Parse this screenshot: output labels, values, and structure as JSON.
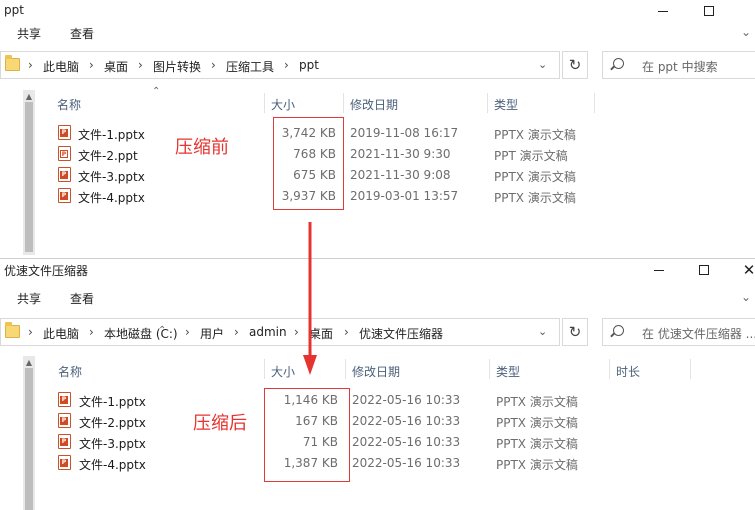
{
  "window1": {
    "title": "ppt",
    "ribbon": {
      "tabs": [
        "共享",
        "查看"
      ]
    },
    "address": {
      "crumbs": [
        "此电脑",
        "桌面",
        "图片转换",
        "压缩工具",
        "ppt"
      ]
    },
    "search_placeholder": "在 ppt 中搜索",
    "columns": {
      "name": "名称",
      "size": "大小",
      "modified": "修改日期",
      "type": "类型"
    },
    "files": [
      {
        "name": "文件-1.pptx",
        "size": "3,742 KB",
        "modified": "2019-11-08 16:17",
        "type": "PPTX 演示文稿"
      },
      {
        "name": "文件-2.ppt",
        "size": "768 KB",
        "modified": "2021-11-30 9:30",
        "type": "PPT 演示文稿"
      },
      {
        "name": "文件-3.pptx",
        "size": "675 KB",
        "modified": "2021-11-30 9:08",
        "type": "PPTX 演示文稿"
      },
      {
        "name": "文件-4.pptx",
        "size": "3,937 KB",
        "modified": "2019-03-01 13:57",
        "type": "PPTX 演示文稿"
      }
    ],
    "annotation": "压缩前"
  },
  "window2": {
    "title": "优速文件压缩器",
    "ribbon": {
      "tabs": [
        "共享",
        "查看"
      ]
    },
    "address": {
      "crumbs": [
        "此电脑",
        "本地磁盘 (C:)",
        "用户",
        "admin",
        "桌面",
        "优速文件压缩器"
      ]
    },
    "search_placeholder": "在 优速文件压缩器 ...",
    "columns": {
      "name": "名称",
      "size": "大小",
      "modified": "修改日期",
      "type": "类型",
      "duration": "时长"
    },
    "files": [
      {
        "name": "文件-1.pptx",
        "size": "1,146 KB",
        "modified": "2022-05-16 10:33",
        "type": "PPTX 演示文稿"
      },
      {
        "name": "文件-2.pptx",
        "size": "167 KB",
        "modified": "2022-05-16 10:33",
        "type": "PPTX 演示文稿"
      },
      {
        "name": "文件-3.pptx",
        "size": "71 KB",
        "modified": "2022-05-16 10:33",
        "type": "PPTX 演示文稿"
      },
      {
        "name": "文件-4.pptx",
        "size": "1,387 KB",
        "modified": "2022-05-16 10:33",
        "type": "PPTX 演示文稿"
      }
    ],
    "annotation": "压缩后"
  },
  "colors": {
    "annotation_red": "#e5342f",
    "header_text": "#4c607a",
    "date_text": "#6d6d6d"
  },
  "icons": {
    "file": "pptx-file-icon",
    "folder": "folder-icon",
    "search": "search-icon",
    "refresh": "refresh-icon"
  }
}
